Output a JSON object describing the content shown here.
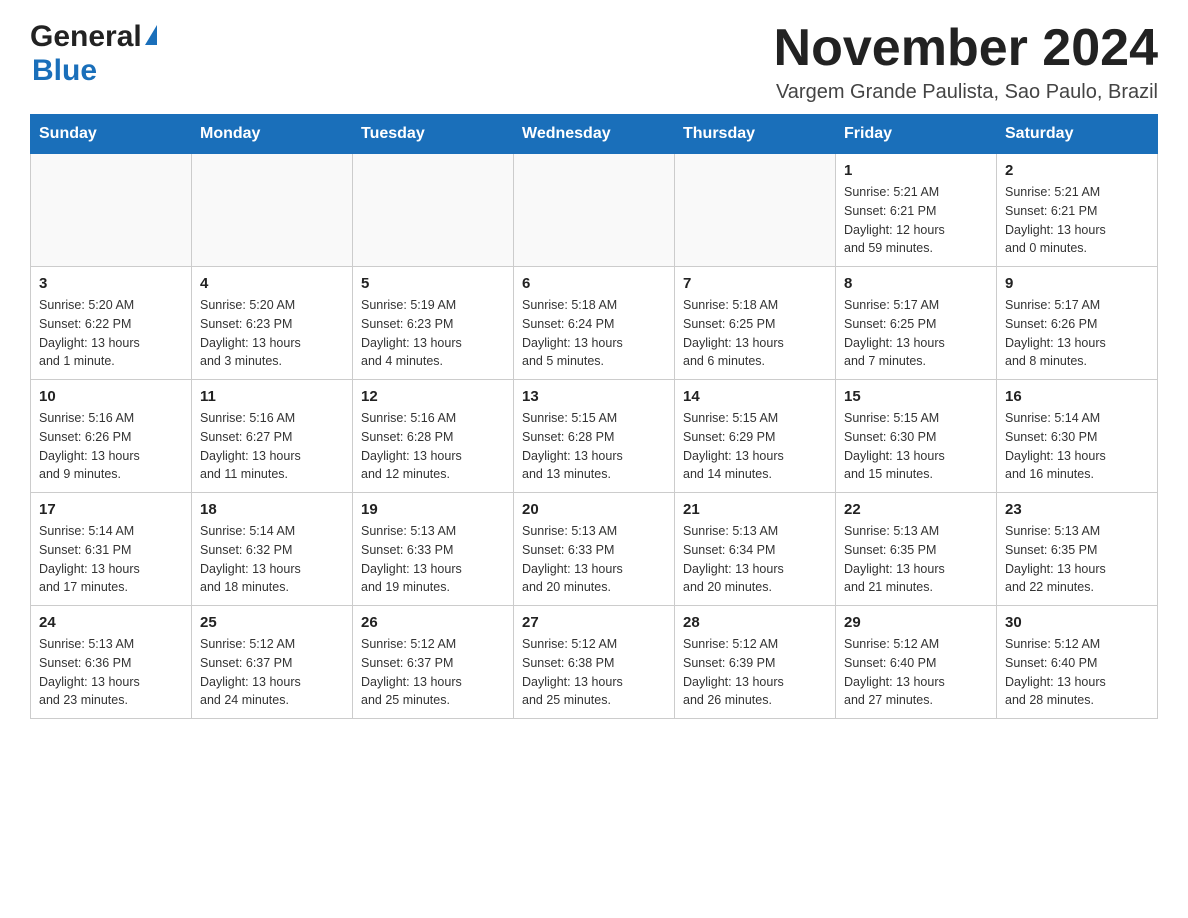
{
  "header": {
    "logo_general": "General",
    "logo_blue": "Blue",
    "month_year": "November 2024",
    "location": "Vargem Grande Paulista, Sao Paulo, Brazil"
  },
  "calendar": {
    "days_of_week": [
      "Sunday",
      "Monday",
      "Tuesday",
      "Wednesday",
      "Thursday",
      "Friday",
      "Saturday"
    ],
    "weeks": [
      [
        {
          "day": "",
          "info": ""
        },
        {
          "day": "",
          "info": ""
        },
        {
          "day": "",
          "info": ""
        },
        {
          "day": "",
          "info": ""
        },
        {
          "day": "",
          "info": ""
        },
        {
          "day": "1",
          "info": "Sunrise: 5:21 AM\nSunset: 6:21 PM\nDaylight: 12 hours\nand 59 minutes."
        },
        {
          "day": "2",
          "info": "Sunrise: 5:21 AM\nSunset: 6:21 PM\nDaylight: 13 hours\nand 0 minutes."
        }
      ],
      [
        {
          "day": "3",
          "info": "Sunrise: 5:20 AM\nSunset: 6:22 PM\nDaylight: 13 hours\nand 1 minute."
        },
        {
          "day": "4",
          "info": "Sunrise: 5:20 AM\nSunset: 6:23 PM\nDaylight: 13 hours\nand 3 minutes."
        },
        {
          "day": "5",
          "info": "Sunrise: 5:19 AM\nSunset: 6:23 PM\nDaylight: 13 hours\nand 4 minutes."
        },
        {
          "day": "6",
          "info": "Sunrise: 5:18 AM\nSunset: 6:24 PM\nDaylight: 13 hours\nand 5 minutes."
        },
        {
          "day": "7",
          "info": "Sunrise: 5:18 AM\nSunset: 6:25 PM\nDaylight: 13 hours\nand 6 minutes."
        },
        {
          "day": "8",
          "info": "Sunrise: 5:17 AM\nSunset: 6:25 PM\nDaylight: 13 hours\nand 7 minutes."
        },
        {
          "day": "9",
          "info": "Sunrise: 5:17 AM\nSunset: 6:26 PM\nDaylight: 13 hours\nand 8 minutes."
        }
      ],
      [
        {
          "day": "10",
          "info": "Sunrise: 5:16 AM\nSunset: 6:26 PM\nDaylight: 13 hours\nand 9 minutes."
        },
        {
          "day": "11",
          "info": "Sunrise: 5:16 AM\nSunset: 6:27 PM\nDaylight: 13 hours\nand 11 minutes."
        },
        {
          "day": "12",
          "info": "Sunrise: 5:16 AM\nSunset: 6:28 PM\nDaylight: 13 hours\nand 12 minutes."
        },
        {
          "day": "13",
          "info": "Sunrise: 5:15 AM\nSunset: 6:28 PM\nDaylight: 13 hours\nand 13 minutes."
        },
        {
          "day": "14",
          "info": "Sunrise: 5:15 AM\nSunset: 6:29 PM\nDaylight: 13 hours\nand 14 minutes."
        },
        {
          "day": "15",
          "info": "Sunrise: 5:15 AM\nSunset: 6:30 PM\nDaylight: 13 hours\nand 15 minutes."
        },
        {
          "day": "16",
          "info": "Sunrise: 5:14 AM\nSunset: 6:30 PM\nDaylight: 13 hours\nand 16 minutes."
        }
      ],
      [
        {
          "day": "17",
          "info": "Sunrise: 5:14 AM\nSunset: 6:31 PM\nDaylight: 13 hours\nand 17 minutes."
        },
        {
          "day": "18",
          "info": "Sunrise: 5:14 AM\nSunset: 6:32 PM\nDaylight: 13 hours\nand 18 minutes."
        },
        {
          "day": "19",
          "info": "Sunrise: 5:13 AM\nSunset: 6:33 PM\nDaylight: 13 hours\nand 19 minutes."
        },
        {
          "day": "20",
          "info": "Sunrise: 5:13 AM\nSunset: 6:33 PM\nDaylight: 13 hours\nand 20 minutes."
        },
        {
          "day": "21",
          "info": "Sunrise: 5:13 AM\nSunset: 6:34 PM\nDaylight: 13 hours\nand 20 minutes."
        },
        {
          "day": "22",
          "info": "Sunrise: 5:13 AM\nSunset: 6:35 PM\nDaylight: 13 hours\nand 21 minutes."
        },
        {
          "day": "23",
          "info": "Sunrise: 5:13 AM\nSunset: 6:35 PM\nDaylight: 13 hours\nand 22 minutes."
        }
      ],
      [
        {
          "day": "24",
          "info": "Sunrise: 5:13 AM\nSunset: 6:36 PM\nDaylight: 13 hours\nand 23 minutes."
        },
        {
          "day": "25",
          "info": "Sunrise: 5:12 AM\nSunset: 6:37 PM\nDaylight: 13 hours\nand 24 minutes."
        },
        {
          "day": "26",
          "info": "Sunrise: 5:12 AM\nSunset: 6:37 PM\nDaylight: 13 hours\nand 25 minutes."
        },
        {
          "day": "27",
          "info": "Sunrise: 5:12 AM\nSunset: 6:38 PM\nDaylight: 13 hours\nand 25 minutes."
        },
        {
          "day": "28",
          "info": "Sunrise: 5:12 AM\nSunset: 6:39 PM\nDaylight: 13 hours\nand 26 minutes."
        },
        {
          "day": "29",
          "info": "Sunrise: 5:12 AM\nSunset: 6:40 PM\nDaylight: 13 hours\nand 27 minutes."
        },
        {
          "day": "30",
          "info": "Sunrise: 5:12 AM\nSunset: 6:40 PM\nDaylight: 13 hours\nand 28 minutes."
        }
      ]
    ]
  }
}
